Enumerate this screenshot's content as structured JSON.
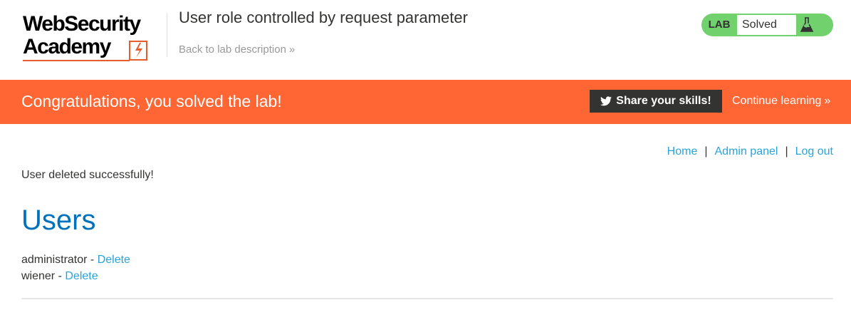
{
  "header": {
    "logo_line1": "WebSecurity",
    "logo_line2": "Academy",
    "lab_title": "User role controlled by request parameter",
    "back_link": "Back to lab description",
    "status_label": "LAB",
    "status_value": "Solved",
    "colors": {
      "status_green": "#70d16d",
      "logo_accent": "#e85d2c"
    },
    "icons": {
      "logo_mark": "lightning-bolt-icon",
      "status_icon": "flask-icon",
      "back_chevron": "double-chevron-right-icon"
    }
  },
  "banner": {
    "message": "Congratulations, you solved the lab!",
    "share_button": "Share your skills!",
    "continue_link": "Continue learning",
    "colors": {
      "background": "#ff6633",
      "button": "#333332"
    },
    "icons": {
      "share": "twitter-icon",
      "continue_chevron": "double-chevron-right-icon"
    }
  },
  "nav": {
    "home": "Home",
    "admin_panel": "Admin panel",
    "logout": "Log out",
    "separator": "|"
  },
  "main": {
    "message": "User deleted successfully!",
    "heading": "Users",
    "users": [
      {
        "name": "administrator",
        "separator": " - ",
        "action": "Delete"
      },
      {
        "name": "wiener",
        "separator": " - ",
        "action": "Delete"
      }
    ]
  }
}
